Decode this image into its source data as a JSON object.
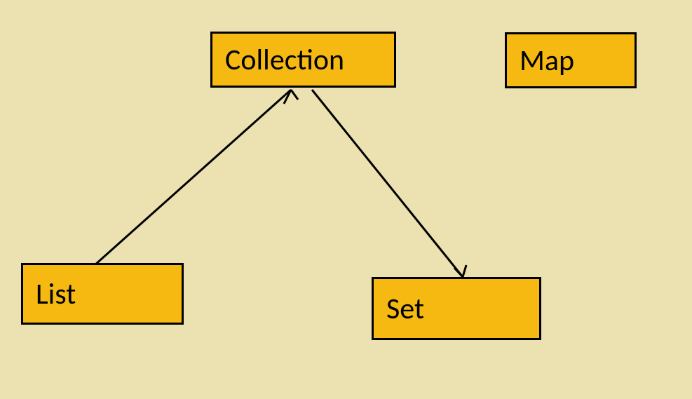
{
  "diagram": {
    "nodes": {
      "collection": {
        "label": "Collection"
      },
      "map": {
        "label": "Map"
      },
      "list": {
        "label": "List"
      },
      "set": {
        "label": "Set"
      }
    },
    "edges": [
      {
        "from": "collection",
        "to": "list"
      },
      {
        "from": "collection",
        "to": "set"
      }
    ],
    "colors": {
      "background": "#ece1b1",
      "node_fill": "#f5b912",
      "node_border": "#000000",
      "edge": "#000000"
    }
  }
}
